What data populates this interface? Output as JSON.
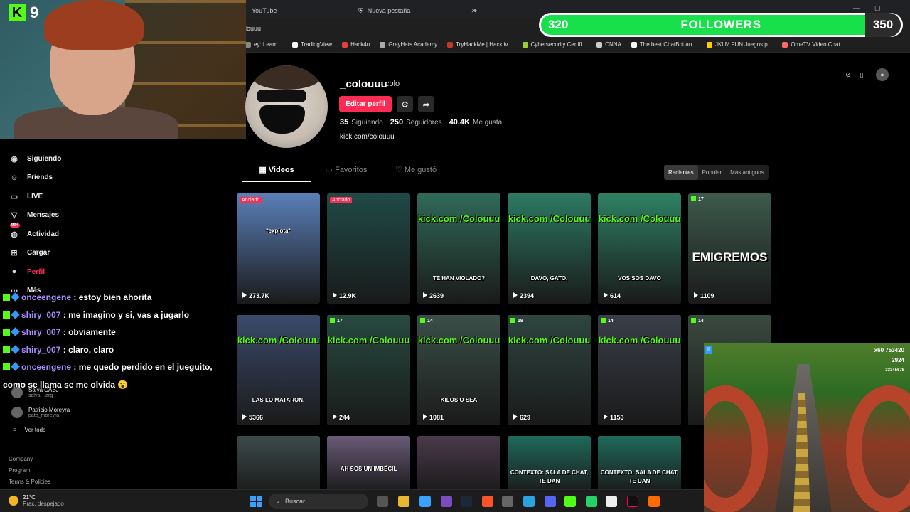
{
  "browser": {
    "tabs": [
      {
        "label": "YouTube"
      },
      {
        "label": "Nueva pestaña"
      }
    ],
    "new_tab": "+",
    "url": "olouuu",
    "bookmarks": [
      {
        "label": "ey: Learn...",
        "color": "#888888"
      },
      {
        "label": "TradingView",
        "color": "#ffffff"
      },
      {
        "label": "Hack4u",
        "color": "#e04040"
      },
      {
        "label": "GreyHats Academy",
        "color": "#aaaaaa"
      },
      {
        "label": "TryHackMe | Hacktiv...",
        "color": "#c0392b"
      },
      {
        "label": "Cybersecurity Certifi...",
        "color": "#9acd32"
      },
      {
        "label": "CNNA",
        "color": "#cccccc"
      },
      {
        "label": "The best ChatBot an...",
        "color": "#ffffff"
      },
      {
        "label": "JKLM.FUN Juegos p...",
        "color": "#ffcc00"
      },
      {
        "label": "OmeTV Video Chat...",
        "color": "#ff6666"
      }
    ]
  },
  "followers_goal": {
    "current": "320",
    "label": "FOLLOWERS",
    "goal": "350",
    "progress": 0.914
  },
  "webcam": {
    "logo": "K",
    "number": "9"
  },
  "sidebar": {
    "items": [
      {
        "label": "Siguiendo",
        "icon": "following-icon"
      },
      {
        "label": "Friends",
        "icon": "friends-icon"
      },
      {
        "label": "LIVE",
        "icon": "live-icon"
      },
      {
        "label": "Mensajes",
        "icon": "messages-icon"
      },
      {
        "label": "Actividad",
        "icon": "activity-icon",
        "badge": "99+"
      },
      {
        "label": "Cargar",
        "icon": "upload-icon"
      },
      {
        "label": "Perfil",
        "icon": "profile-icon"
      },
      {
        "label": "Más",
        "icon": "more-icon"
      }
    ],
    "following_accounts": [
      {
        "name": "Salva CABJ",
        "handle": "salva._.arg"
      },
      {
        "name": "Patricio Moreyra",
        "handle": "pato_moreyra"
      }
    ],
    "see_all": "Ver todo",
    "footer": [
      "Company",
      "Program",
      "Terms & Policies"
    ]
  },
  "chat": [
    {
      "user": "onceengene",
      "text": ": estoy bien ahorita"
    },
    {
      "user": "shiry_007",
      "text": ": me imagino y si, vas a jugarlo"
    },
    {
      "user": "shiry_007",
      "text": ": obviamente"
    },
    {
      "user": "shiry_007",
      "text": ": claro, claro"
    },
    {
      "user": "onceengene",
      "text": ": me quedo perdido en el jueguito, como se llama se me olvida 😮"
    }
  ],
  "profile": {
    "username": "_colouuu",
    "nickname": "colo",
    "edit_button": "Editar perfil",
    "following_count": "35",
    "following_label": "Siguiendo",
    "followers_count": "250",
    "followers_label": "Seguidores",
    "likes_count": "40.4K",
    "likes_label": "Me gusta",
    "link": "kick.com/colouuu"
  },
  "tabs": [
    {
      "label": "Videos",
      "icon": "grid-icon"
    },
    {
      "label": "Favoritos",
      "icon": "bookmark-icon"
    },
    {
      "label": "Me gustó",
      "icon": "heart-icon"
    }
  ],
  "sort": [
    "Recientes",
    "Popular",
    "Más antiguos"
  ],
  "videos": [
    {
      "pinned": "Anclado",
      "views": "273.7K",
      "bg": "#5b7fb8",
      "caption": "*explota*",
      "kick": ""
    },
    {
      "pinned": "Anclado",
      "views": "12.9K",
      "bg": "#1f4a47",
      "caption": "",
      "kick": ""
    },
    {
      "pinned": "",
      "views": "2639",
      "bg": "#2f6a58",
      "caption": "TE HAN VIOLADO?",
      "kick": "kick.com /Colouuu"
    },
    {
      "pinned": "",
      "views": "2394",
      "bg": "#2c7a62",
      "caption": "DAVO, GATO,",
      "kick": "kick.com /Colouuu"
    },
    {
      "pinned": "",
      "views": "614",
      "bg": "#2e8164",
      "caption": "VOS SOS DAVO",
      "kick": "kick.com /Colouuu"
    },
    {
      "pinned": "",
      "views": "1109",
      "bg": "#3d5a4c",
      "caption": "EMIGREMOS",
      "kick": "",
      "badge": "17"
    },
    {
      "pinned": "",
      "views": "5366",
      "bg": "#3a4a6a",
      "caption": "LAS LO MATARON.",
      "kick": "kick.com /Colouuu"
    },
    {
      "pinned": "",
      "views": "244",
      "bg": "#274a40",
      "caption": "",
      "kick": "kick.com /Colouuu",
      "badge": "17"
    },
    {
      "pinned": "",
      "views": "1081",
      "bg": "#3a4f48",
      "caption": "KILOS O SEA",
      "kick": "kick.com /Colouuu",
      "badge": "14"
    },
    {
      "pinned": "",
      "views": "629",
      "bg": "#2e4540",
      "caption": "",
      "kick": "kick.com /Colouuu",
      "badge": "19"
    },
    {
      "pinned": "",
      "views": "1153",
      "bg": "#3a3e48",
      "caption": "",
      "kick": "kick.com /Colouuu",
      "badge": "14"
    },
    {
      "pinned": "",
      "views": "",
      "bg": "#3a4a40",
      "caption": "",
      "kick": "",
      "badge": "14"
    },
    {
      "pinned": "",
      "views": "",
      "bg": "#3e4a4a",
      "caption": "",
      "kick": ""
    },
    {
      "pinned": "",
      "views": "",
      "bg": "#6a5a78",
      "caption": "AH SOS UN IMBÉCIL",
      "kick": ""
    },
    {
      "pinned": "",
      "views": "",
      "bg": "#4a3a4a",
      "caption": "",
      "kick": ""
    },
    {
      "pinned": "",
      "views": "",
      "bg": "#1f6a5a",
      "caption": "CONTEXTO: SALA DE CHAT, TE DAN",
      "kick": ""
    },
    {
      "pinned": "",
      "views": "",
      "bg": "#1f6a5a",
      "caption": "CONTEXTO: SALA DE CHAT, TE DAN",
      "kick": ""
    }
  ],
  "game": {
    "score": "753420",
    "coins": "2924",
    "multiplier": "x60",
    "extra": "33345678"
  },
  "taskbar": {
    "temp": "21°C",
    "weather": "Prac. despejado",
    "search": "Buscar"
  }
}
